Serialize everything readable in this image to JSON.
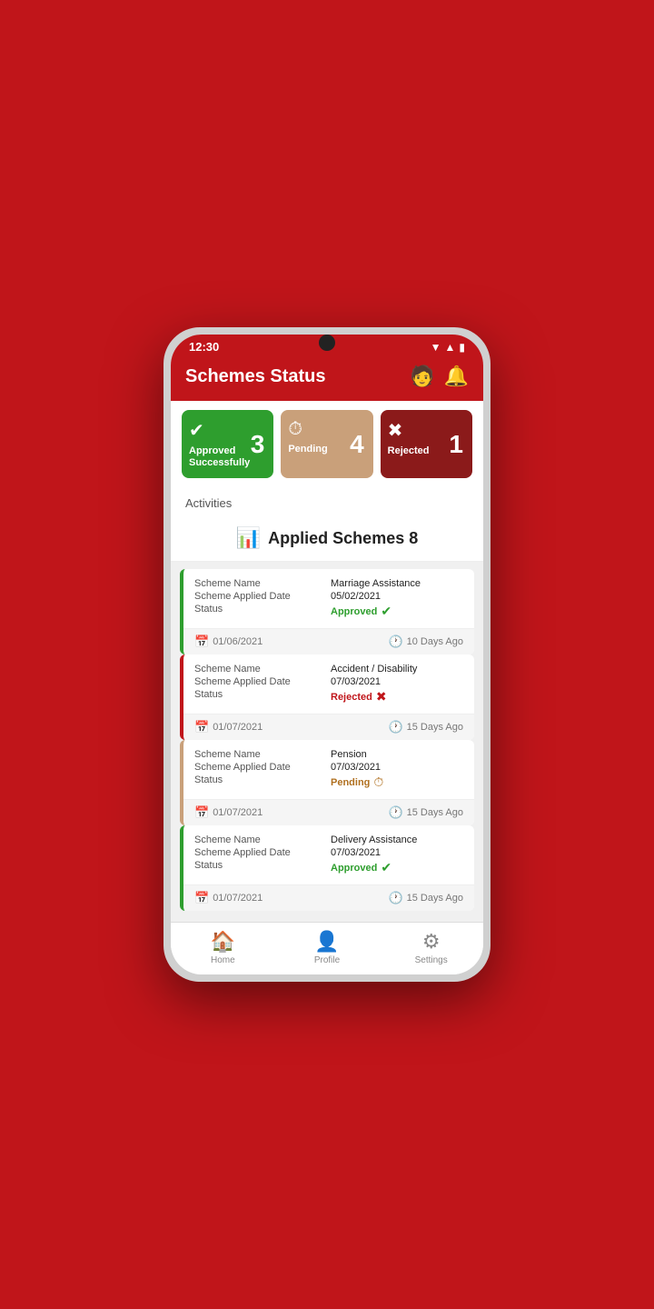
{
  "statusBar": {
    "time": "12:30"
  },
  "header": {
    "title": "Schemes Status"
  },
  "stats": [
    {
      "label": "Approved Successfully",
      "count": "3",
      "type": "approved",
      "icon": "✔"
    },
    {
      "label": "Pending",
      "count": "4",
      "type": "pending",
      "icon": "⏱"
    },
    {
      "label": "Rejected",
      "count": "1",
      "type": "rejected",
      "icon": "✖"
    }
  ],
  "activitiesLabel": "Activities",
  "appliedSchemes": {
    "title": "Applied  Schemes  8"
  },
  "schemes": [
    {
      "name": "Marriage Assistance",
      "appliedDate": "05/02/2021",
      "status": "Approved",
      "statusType": "approved",
      "date": "01/06/2021",
      "daysAgo": "10 Days Ago",
      "borderType": "approved"
    },
    {
      "name": "Accident / Disability",
      "appliedDate": "07/03/2021",
      "status": "Rejected",
      "statusType": "rejected",
      "date": "01/07/2021",
      "daysAgo": "15 Days Ago",
      "borderType": "rejected"
    },
    {
      "name": "Pension",
      "appliedDate": "07/03/2021",
      "status": "Pending",
      "statusType": "pending",
      "date": "01/07/2021",
      "daysAgo": "15 Days Ago",
      "borderType": "pending"
    },
    {
      "name": "Delivery Assistance",
      "appliedDate": "07/03/2021",
      "status": "Approved",
      "statusType": "approved",
      "date": "01/07/2021",
      "daysAgo": "15 Days Ago",
      "borderType": "approved"
    }
  ],
  "fieldLabels": {
    "schemeName": "Scheme Name",
    "appliedDate": "Scheme Applied Date",
    "status": "Status"
  },
  "nav": [
    {
      "label": "Home",
      "icon": "🏠"
    },
    {
      "label": "Profile",
      "icon": "👤"
    },
    {
      "label": "Settings",
      "icon": "⚙"
    }
  ]
}
